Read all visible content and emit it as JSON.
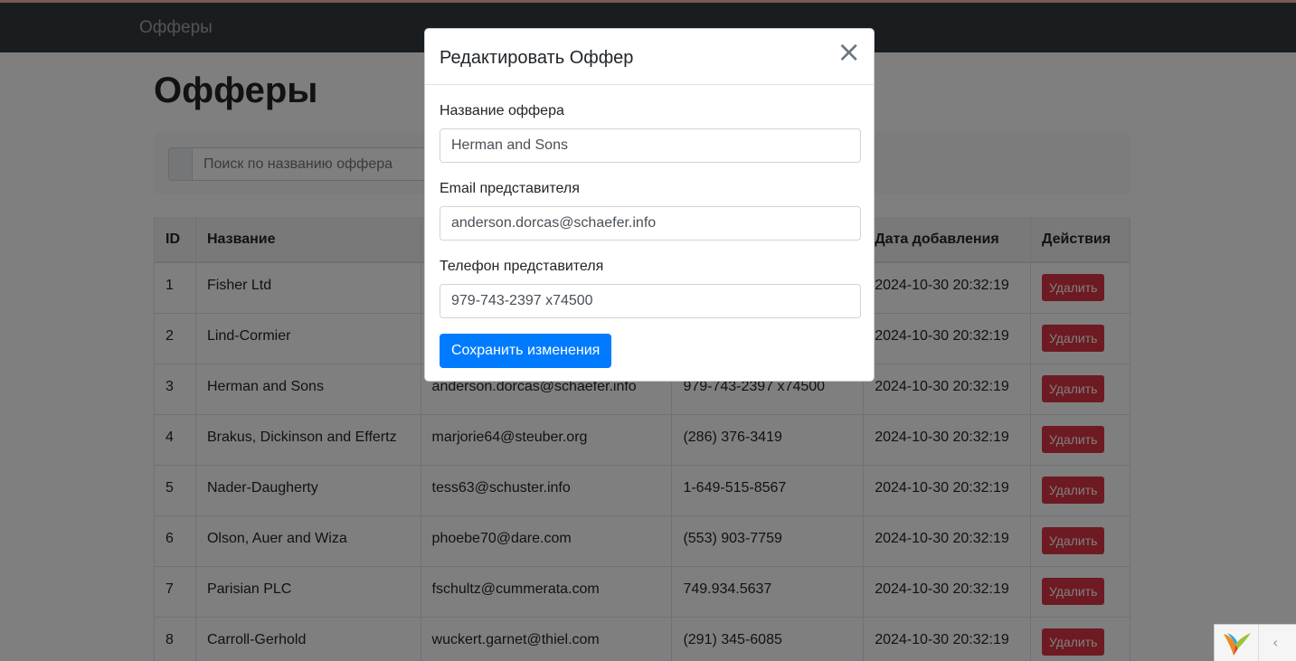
{
  "navbar": {
    "brand": "Офферы"
  },
  "page": {
    "title": "Офферы"
  },
  "search": {
    "placeholder": "Поиск по названию оффера"
  },
  "table": {
    "columns": [
      "ID",
      "Название",
      "",
      "",
      "Дата добавления",
      "Действия"
    ],
    "rows": [
      {
        "id": "1",
        "name": "Fisher Ltd",
        "email": "",
        "phone": "",
        "date": "2024-10-30 20:32:19",
        "action": "Удалить"
      },
      {
        "id": "2",
        "name": "Lind-Cormier",
        "email": "",
        "phone": "",
        "date": "2024-10-30 20:32:19",
        "action": "Удалить"
      },
      {
        "id": "3",
        "name": "Herman and Sons",
        "email": "anderson.dorcas@schaefer.info",
        "phone": "979-743-2397 x74500",
        "date": "2024-10-30 20:32:19",
        "action": "Удалить"
      },
      {
        "id": "4",
        "name": "Brakus, Dickinson and Effertz",
        "email": "marjorie64@steuber.org",
        "phone": "(286) 376-3419",
        "date": "2024-10-30 20:32:19",
        "action": "Удалить"
      },
      {
        "id": "5",
        "name": "Nader-Daugherty",
        "email": "tess63@schuster.info",
        "phone": "1-649-515-8567",
        "date": "2024-10-30 20:32:19",
        "action": "Удалить"
      },
      {
        "id": "6",
        "name": "Olson, Auer and Wiza",
        "email": "phoebe70@dare.com",
        "phone": "(553) 903-7759",
        "date": "2024-10-30 20:32:19",
        "action": "Удалить"
      },
      {
        "id": "7",
        "name": "Parisian PLC",
        "email": "fschultz@cummerata.com",
        "phone": "749.934.5637",
        "date": "2024-10-30 20:32:19",
        "action": "Удалить"
      },
      {
        "id": "8",
        "name": "Carroll-Gerhold",
        "email": "wuckert.garnet@thiel.com",
        "phone": "(291) 345-6085",
        "date": "2024-10-30 20:32:19",
        "action": "Удалить"
      }
    ]
  },
  "modal": {
    "title": "Редактировать Оффер",
    "close": "×",
    "name_label": "Название оффера",
    "name_value": "Herman and Sons",
    "email_label": "Email представителя",
    "email_value": "anderson.dorcas@schaefer.info",
    "phone_label": "Телефон представителя",
    "phone_value": "979-743-2397 x74500",
    "save_label": "Сохранить изменения"
  },
  "debug": {
    "collapse": "‹"
  }
}
